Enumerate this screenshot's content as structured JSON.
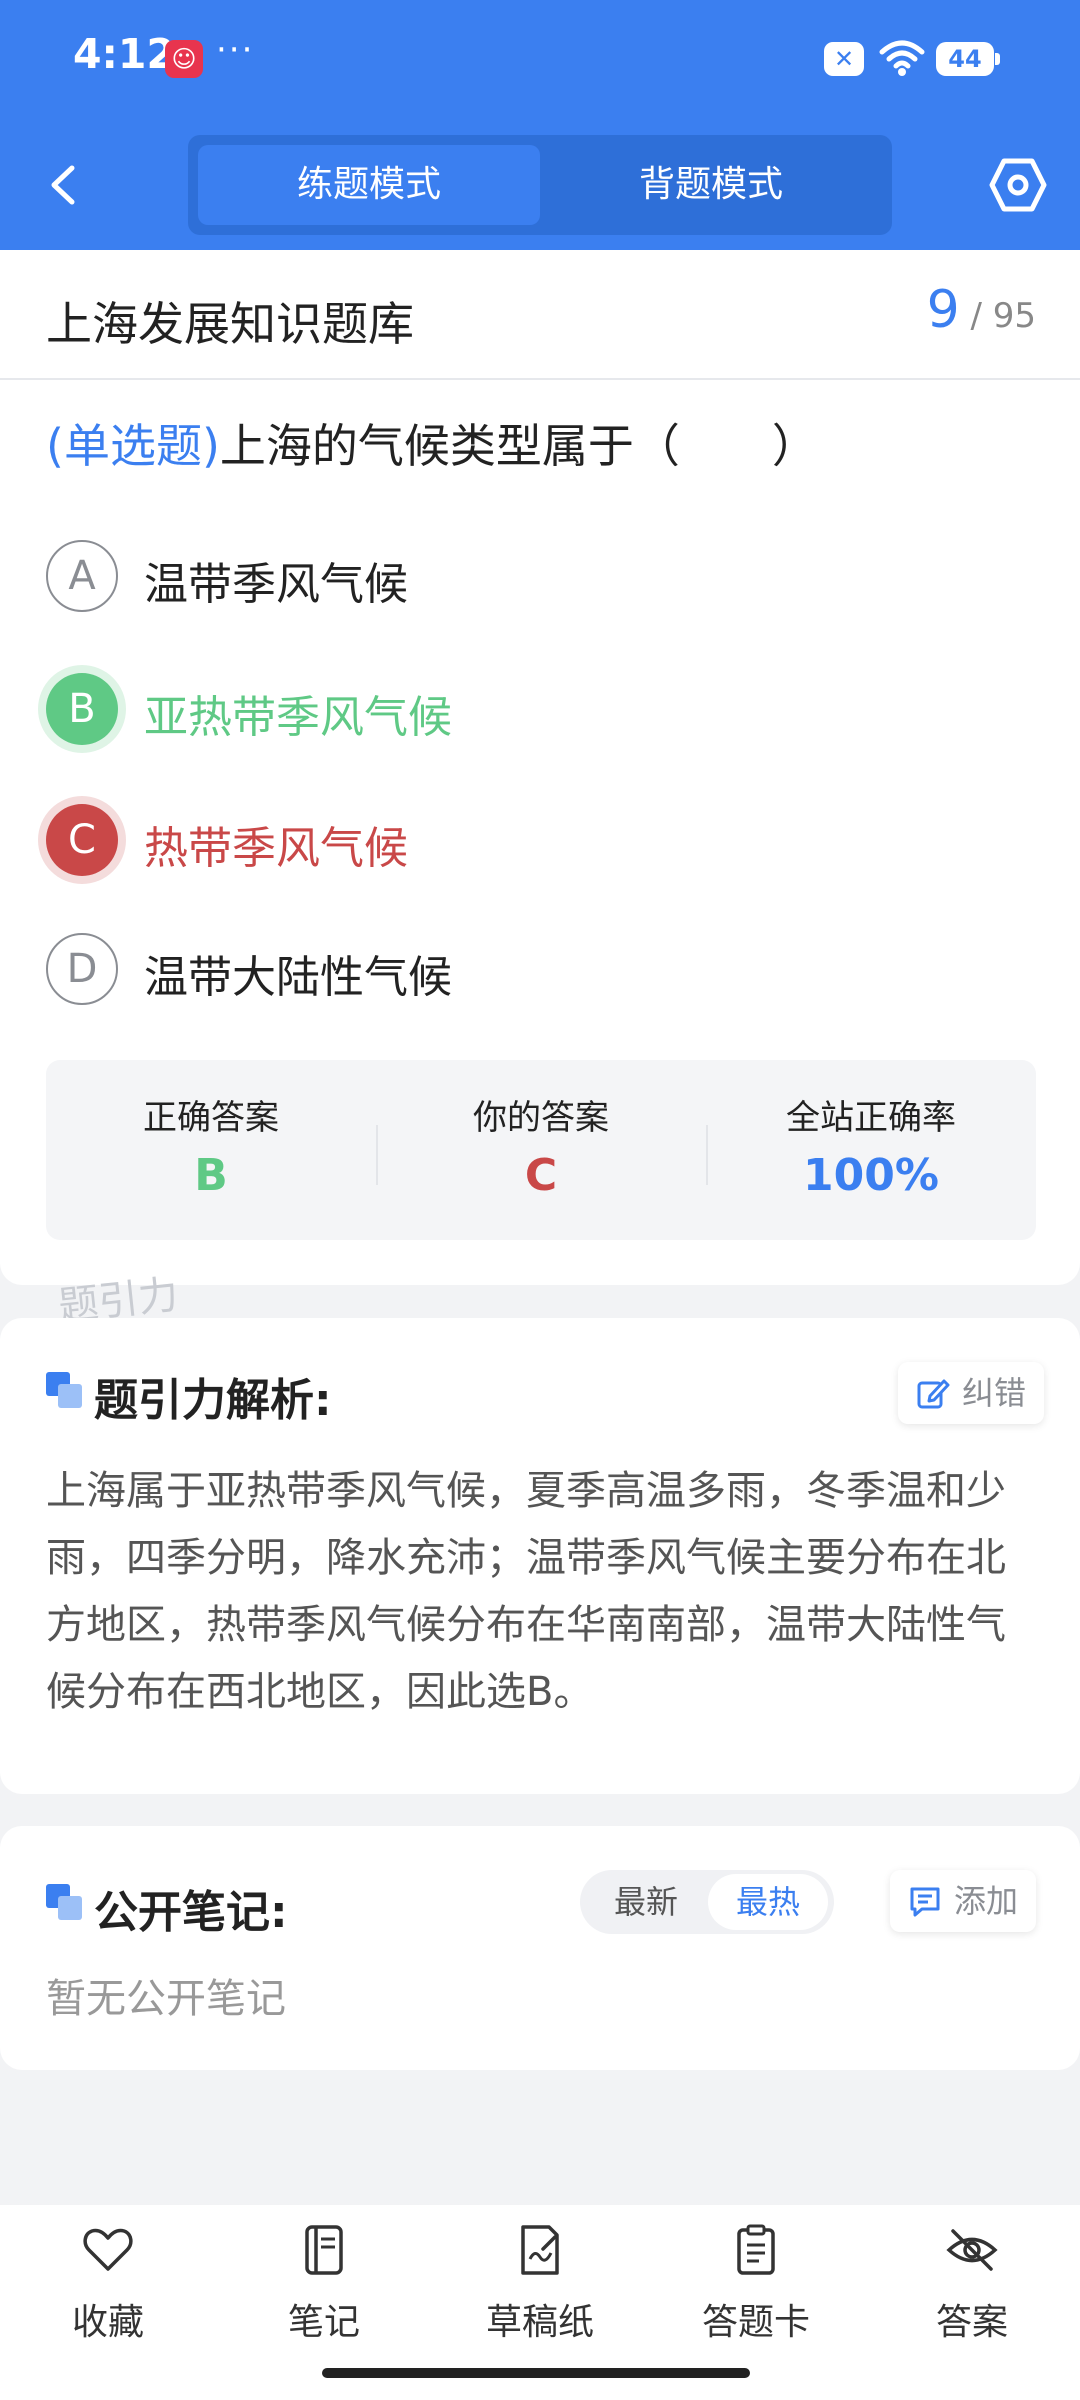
{
  "status_bar": {
    "time": "4:12",
    "dots": "···",
    "battery": "44"
  },
  "header": {
    "mode_tabs": [
      "练题模式",
      "背题模式"
    ],
    "active_mode": "练题模式"
  },
  "question_card": {
    "bank_title": "上海发展知识题库",
    "progress_current": "9",
    "progress_total": "/ 95",
    "question_type": "(单选题)",
    "question_text": "上海的气候类型属于（　　）",
    "options": [
      {
        "letter": "A",
        "text": "温带季风气候",
        "state": "normal"
      },
      {
        "letter": "B",
        "text": "亚热带季风气候",
        "state": "correct"
      },
      {
        "letter": "C",
        "text": "热带季风气候",
        "state": "wrong"
      },
      {
        "letter": "D",
        "text": "温带大陆性气候",
        "state": "normal"
      }
    ],
    "stats": [
      {
        "label": "正确答案",
        "value": "B",
        "color": "#5fc985"
      },
      {
        "label": "你的答案",
        "value": "C",
        "color": "#c94848"
      },
      {
        "label": "全站正确率",
        "value": "100%",
        "color": "#3b7ff0"
      }
    ]
  },
  "watermark": "题引力",
  "analysis": {
    "title": "题引力解析:",
    "report_label": "纠错",
    "text": "上海属于亚热带季风气候，夏季高温多雨，冬季温和少雨，四季分明，降水充沛；温带季风气候主要分布在北方地区，热带季风气候分布在华南南部，温带大陆性气候分布在西北地区，因此选B。"
  },
  "notes": {
    "title": "公开笔记:",
    "sort_latest": "最新",
    "sort_hot": "最热",
    "add_label": "添加",
    "empty_text": "暂无公开笔记"
  },
  "bottom_nav": {
    "items": [
      {
        "label": "收藏",
        "icon": "heart-icon"
      },
      {
        "label": "笔记",
        "icon": "notebook-icon"
      },
      {
        "label": "草稿纸",
        "icon": "draft-icon"
      },
      {
        "label": "答题卡",
        "icon": "answer-sheet-icon"
      },
      {
        "label": "答案",
        "icon": "eye-off-icon"
      }
    ]
  },
  "colors": {
    "primary": "#3b7ff0",
    "correct": "#5fc985",
    "wrong": "#c94848"
  }
}
